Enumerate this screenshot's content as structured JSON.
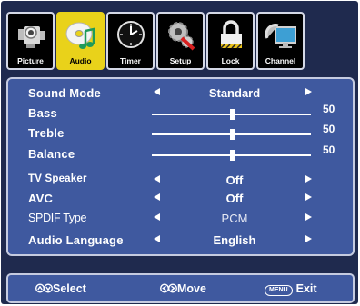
{
  "tabs": [
    {
      "label": "Picture",
      "icon": "camera-icon"
    },
    {
      "label": "Audio",
      "icon": "cd-music-icon",
      "active": true
    },
    {
      "label": "Timer",
      "icon": "clock-icon"
    },
    {
      "label": "Setup",
      "icon": "gear-wrench-icon"
    },
    {
      "label": "Lock",
      "icon": "padlock-icon"
    },
    {
      "label": "Channel",
      "icon": "satellite-monitor-icon"
    }
  ],
  "audio_menu": {
    "sound_mode": {
      "label": "Sound Mode",
      "value": "Standard"
    },
    "bass": {
      "label": "Bass",
      "value": "50",
      "level": 50
    },
    "treble": {
      "label": "Treble",
      "value": "50",
      "level": 50
    },
    "balance": {
      "label": "Balance",
      "value": "50",
      "level": 50
    },
    "tv_speaker": {
      "label": "TV Speaker",
      "value": "Off"
    },
    "avc": {
      "label": "AVC",
      "value": "Off"
    },
    "spdif_type": {
      "label": "SPDIF Type",
      "value": "PCM"
    },
    "audio_language": {
      "label": "Audio Language",
      "value": "English"
    }
  },
  "footer": {
    "select_label": "Select",
    "move_label": "Move",
    "menu_key": "MENU",
    "exit_label": "Exit"
  },
  "colors": {
    "panel_blue": "#3f599f",
    "frame_navy": "#1f2a4e",
    "active_tab_yellow": "#e9d21a"
  }
}
